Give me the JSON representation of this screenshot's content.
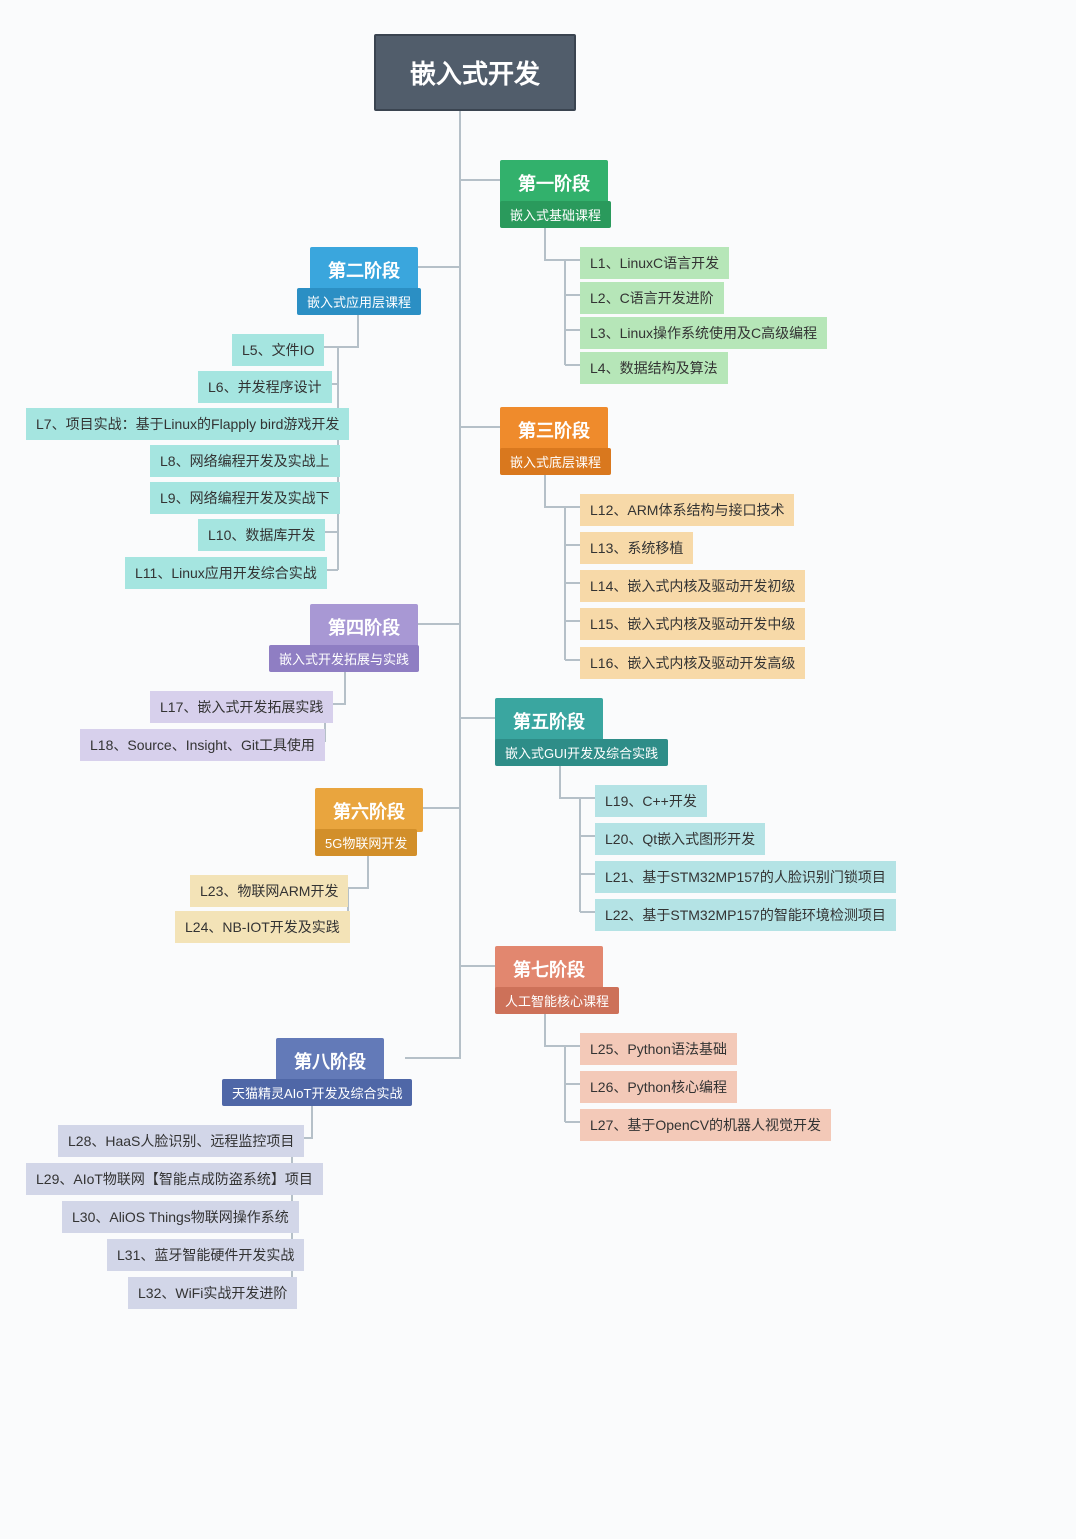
{
  "root": "嵌入式开发",
  "stages": {
    "s1": {
      "title": "第一阶段",
      "subtitle": "嵌入式基础课程",
      "color": "#32b16c",
      "sub_color": "#2a9a5c",
      "leaf_bg": "#b6e6b8"
    },
    "s2": {
      "title": "第二阶段",
      "subtitle": "嵌入式应用层课程",
      "color": "#3aa6dd",
      "sub_color": "#2b8fc4",
      "leaf_bg": "#a5e5e0"
    },
    "s3": {
      "title": "第三阶段",
      "subtitle": "嵌入式底层课程",
      "color": "#ef8b2c",
      "sub_color": "#d9781e",
      "leaf_bg": "#f7d9a8"
    },
    "s4": {
      "title": "第四阶段",
      "subtitle": "嵌入式开发拓展与实践",
      "color": "#a898d4",
      "sub_color": "#8f7ec3",
      "leaf_bg": "#d7d0ec"
    },
    "s5": {
      "title": "第五阶段",
      "subtitle": "嵌入式GUI开发及综合实践",
      "color": "#3aa6a0",
      "sub_color": "#2e8d88",
      "leaf_bg": "#b4e3e5"
    },
    "s6": {
      "title": "第六阶段",
      "subtitle": "5G物联网开发",
      "color": "#e9a53e",
      "sub_color": "#d28f2a",
      "leaf_bg": "#f3e3b7"
    },
    "s7": {
      "title": "第七阶段",
      "subtitle": "人工智能核心课程",
      "color": "#e2876f",
      "sub_color": "#cd7159",
      "leaf_bg": "#f3c9b8"
    },
    "s8": {
      "title": "第八阶段",
      "subtitle": "天猫精灵AIoT开发及综合实战",
      "color": "#637ab8",
      "sub_color": "#4f67a7",
      "leaf_bg": "#d2d6e8"
    }
  },
  "leaves": {
    "l1": "L1、LinuxC语言开发",
    "l2": "L2、C语言开发进阶",
    "l3": "L3、Linux操作系统使用及C高级编程",
    "l4": "L4、数据结构及算法",
    "l5": "L5、文件IO",
    "l6": "L6、并发程序设计",
    "l7": "L7、项目实战：基于Linux的Flapply bird游戏开发",
    "l8": "L8、网络编程开发及实战上",
    "l9": "L9、网络编程开发及实战下",
    "l10": "L10、数据库开发",
    "l11": "L11、Linux应用开发综合实战",
    "l12": "L12、ARM体系结构与接口技术",
    "l13": "L13、系统移植",
    "l14": "L14、嵌入式内核及驱动开发初级",
    "l15": "L15、嵌入式内核及驱动开发中级",
    "l16": "L16、嵌入式内核及驱动开发高级",
    "l17": "L17、嵌入式开发拓展实践",
    "l18": "L18、Source、Insight、Git工具使用",
    "l19": "L19、C++开发",
    "l20": "L20、Qt嵌入式图形开发",
    "l21": "L21、基于STM32MP157的人脸识别门锁项目",
    "l22": "L22、基于STM32MP157的智能环境检测项目",
    "l23": "L23、物联网ARM开发",
    "l24": "L24、NB-IOT开发及实践",
    "l25": "L25、Python语法基础",
    "l26": "L26、Python核心编程",
    "l27": "L27、基于OpenCV的机器人视觉开发",
    "l28": "L28、HaaS人脸识别、远程监控项目",
    "l29": "L29、AIoT物联网【智能点成防盗系统】项目",
    "l30": "L30、AliOS Things物联网操作系统",
    "l31": "L31、蓝牙智能硬件开发实战",
    "l32": "L32、WiFi实战开发进阶"
  }
}
